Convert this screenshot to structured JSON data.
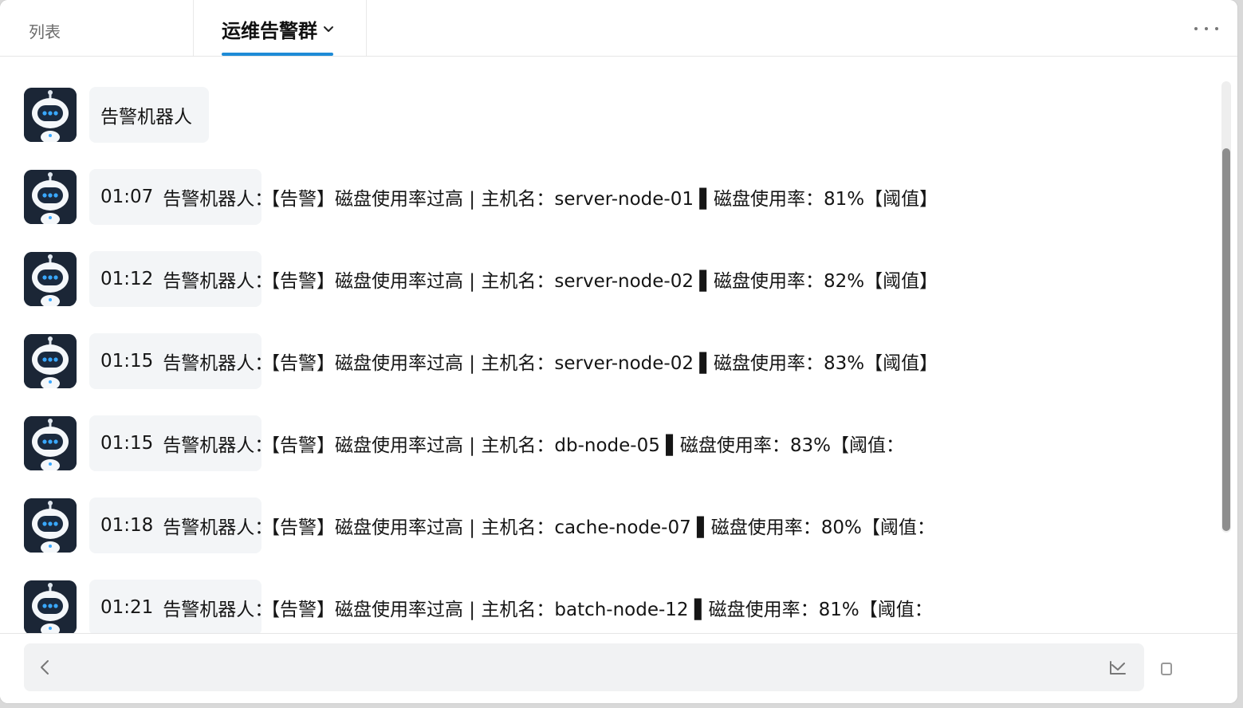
{
  "header": {
    "list_tab": "列表",
    "group_tab": "运维告警群"
  },
  "messages": [
    {
      "sender": "告警机器人",
      "time": "",
      "text": ""
    },
    {
      "sender": "告警机器人：",
      "time": "01:07",
      "text": "【告警】磁盘使用率过高 | 主机名：server-node-01 ▌磁盘使用率：81%【阈值】"
    },
    {
      "sender": "告警机器人：",
      "time": "01:12",
      "text": "【告警】磁盘使用率过高 | 主机名：server-node-02 ▌磁盘使用率：82%【阈值】"
    },
    {
      "sender": "告警机器人：",
      "time": "01:15",
      "text": "【告警】磁盘使用率过高 | 主机名：server-node-02 ▌磁盘使用率：83%【阈值】"
    },
    {
      "sender": "告警机器人：",
      "time": "01:15",
      "text": "【告警】磁盘使用率过高 | 主机名：db-node-05 ▌磁盘使用率：83%【阈值："
    },
    {
      "sender": "告警机器人：",
      "time": "01:18",
      "text": "【告警】磁盘使用率过高 | 主机名：cache-node-07 ▌磁盘使用率：80%【阈值："
    },
    {
      "sender": "告警机器人：",
      "time": "01:21",
      "text": "【告警】磁盘使用率过高 | 主机名：batch-node-12 ▌磁盘使用率：81%【阈值："
    }
  ],
  "colors": {
    "accent": "#1e8bd6",
    "avatar_bg": "#1b2636",
    "bubble_bg": "#f3f5f7"
  },
  "icons": {
    "tab_dropdown": "chevron-down-icon",
    "more": "more-icon",
    "avatar": "robot-avatar-icon",
    "back": "chevron-left-icon",
    "send": "send-icon"
  },
  "scroll": {
    "position_fraction": 0.15,
    "visible_fraction": 0.85
  }
}
